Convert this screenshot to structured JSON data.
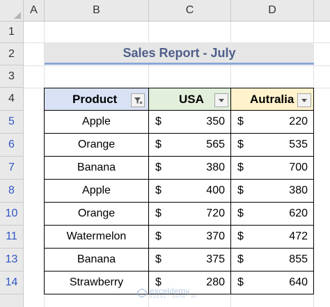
{
  "spreadsheet": {
    "columns": [
      "A",
      "B",
      "C",
      "D"
    ],
    "rows": [
      "1",
      "2",
      "3",
      "4",
      "5",
      "6",
      "7",
      "8",
      "10",
      "11",
      "13",
      "14"
    ]
  },
  "report": {
    "title": "Sales Report - July"
  },
  "table": {
    "headers": {
      "product": "Product",
      "usa": "USA",
      "australia": "Autralia"
    },
    "currency": "$",
    "rows": [
      {
        "product": "Apple",
        "usa": "350",
        "australia": "220"
      },
      {
        "product": "Orange",
        "usa": "565",
        "australia": "535"
      },
      {
        "product": "Banana",
        "usa": "380",
        "australia": "700"
      },
      {
        "product": "Apple",
        "usa": "400",
        "australia": "380"
      },
      {
        "product": "Orange",
        "usa": "720",
        "australia": "620"
      },
      {
        "product": "Watermelon",
        "usa": "370",
        "australia": "472"
      },
      {
        "product": "Banana",
        "usa": "375",
        "australia": "855"
      },
      {
        "product": "Strawberry",
        "usa": "280",
        "australia": "640"
      }
    ],
    "header_colors": {
      "product": "#d9e1f4",
      "usa": "#e2efda",
      "australia": "#fff2cc"
    }
  },
  "icons": {
    "filter_active": "filter-funnel-icon",
    "dropdown": "dropdown-arrow-icon"
  },
  "watermark": {
    "brand": "exceldemy",
    "tagline": "EXCEL · DATA · BI"
  }
}
